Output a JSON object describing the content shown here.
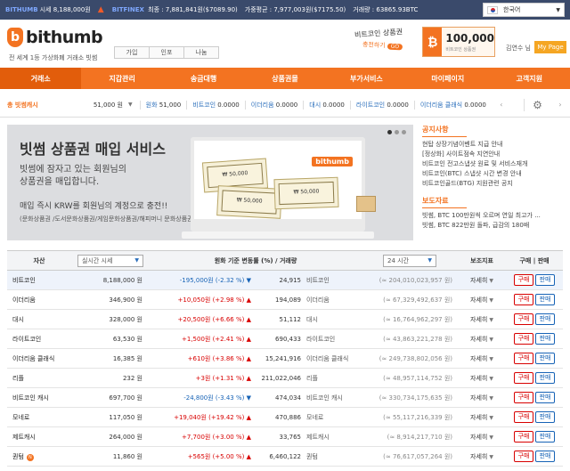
{
  "topbar": {
    "brand1": "BITHUMB",
    "label1": "시세",
    "value1": "8,188,000원",
    "brand2": "BITFINEX",
    "label2": "최종 : 7,881,841원($7089.90)",
    "label3": "가중평균 : 7,977,003원($7175.50)",
    "label4": "거래량 : 63865.93BTC",
    "language": "한국어"
  },
  "header": {
    "logo": "bithumb",
    "tagline": "전 세계 1등 가상화폐 거래소 빗썸",
    "quick": [
      "가입",
      "인포",
      "나눔"
    ],
    "gift_title": "비트코인 상품권",
    "gift_sub": "충전하기",
    "gift_go": "GO",
    "voucher_amount": "100,000",
    "voucher_caption": "비트코인 상품권",
    "user": "김연수 님",
    "mypage": "My Page"
  },
  "nav": [
    "거래소",
    "지갑관리",
    "송금대행",
    "상품권몰",
    "부가서비스",
    "마이페이지",
    "고객지원"
  ],
  "balance": {
    "label": "총 빗썸캐시",
    "amount": "51,000 원",
    "items": [
      {
        "k": "원화",
        "v": "51,000"
      },
      {
        "k": "비트코인",
        "v": "0.0000"
      },
      {
        "k": "이더리움",
        "v": "0.0000"
      },
      {
        "k": "대시",
        "v": "0.0000"
      },
      {
        "k": "라이트코인",
        "v": "0.0000"
      },
      {
        "k": "이더리움 클래식",
        "v": "0.0000"
      }
    ]
  },
  "banner": {
    "title": "빗썸 상품권 매입 서비스",
    "line1": "빗썸에 잠자고 있는 회원님의",
    "line2": "상품권을 매입합니다.",
    "line3": "매입 즉시 KRW를 회원님의 계정으로 충전!!",
    "line4": "(문화상품권 /도서문화상품권/게임문화상품권/해피머니 문화상품권)",
    "screen_logo": "bithumb",
    "ticket_amount": "₩ 50,000"
  },
  "notices": {
    "title": "공지사항",
    "items": [
      "현탑 상장기념이벤트 지급 안내",
      "[정상화] 사이트점속 지연안내",
      "비트코인 전고스냅샷 원료 및 서비스재개",
      "비트코인(BTC) 스냅샷 시간 변경 안내",
      "비트코인골드(BTG) 지원관련 공지"
    ],
    "press_title": "보도자료",
    "press": [
      "빗썸, BTC 100만원씩 오르며 연일 최고가 ...",
      "빗썸, BTC 822만원 돌파, 급감의 180배"
    ]
  },
  "table": {
    "headers": {
      "asset": "자산",
      "price_select": "실시간 시세",
      "change": "원화 기준 변동률 (%) / 거래량",
      "period_select": "24 시간",
      "indicator": "보조지표",
      "trade": "구매 | 판매"
    },
    "detail_label": "자세히",
    "buy_label": "구매",
    "sell_label": "판매",
    "rows": [
      {
        "name": "비트코인",
        "price": "8,188,000 원",
        "chg": "-195,000원 (-2.32 %)",
        "dir": "down",
        "vol": "24,915",
        "unit": "비트코인",
        "krw": "(≈ 204,010,023,957 원)"
      },
      {
        "name": "이더리움",
        "price": "346,900 원",
        "chg": "+10,050원 (+2.98 %)",
        "dir": "up",
        "vol": "194,089",
        "unit": "이더리움",
        "krw": "(≈ 67,329,492,637 원)"
      },
      {
        "name": "대시",
        "price": "328,000 원",
        "chg": "+20,500원 (+6.66 %)",
        "dir": "up",
        "vol": "51,112",
        "unit": "대시",
        "krw": "(≈ 16,764,962,297 원)"
      },
      {
        "name": "라이트코인",
        "price": "63,530 원",
        "chg": "+1,500원 (+2.41 %)",
        "dir": "up",
        "vol": "690,433",
        "unit": "라이트코인",
        "krw": "(≈ 43,863,221,278 원)"
      },
      {
        "name": "이더리움 클래식",
        "price": "16,385 원",
        "chg": "+610원 (+3.86 %)",
        "dir": "up",
        "vol": "15,241,916",
        "unit": "이더리움 클래식",
        "krw": "(≈ 249,738,802,056 원)"
      },
      {
        "name": "리플",
        "price": "232 원",
        "chg": "+3원 (+1.31 %)",
        "dir": "up",
        "vol": "211,022,046",
        "unit": "리플",
        "krw": "(≈ 48,957,114,752 원)"
      },
      {
        "name": "비트코인 캐시",
        "price": "697,700 원",
        "chg": "-24,800원 (-3.43 %)",
        "dir": "down",
        "vol": "474,034",
        "unit": "비트코인 캐시",
        "krw": "(≈ 330,734,175,635 원)"
      },
      {
        "name": "모네로",
        "price": "117,050 원",
        "chg": "+19,040원 (+19.42 %)",
        "dir": "up",
        "vol": "470,886",
        "unit": "모네로",
        "krw": "(≈ 55,117,216,339 원)"
      },
      {
        "name": "제트캐시",
        "price": "264,000 원",
        "chg": "+7,700원 (+3.00 %)",
        "dir": "up",
        "vol": "33,765",
        "unit": "제트캐시",
        "krw": "(≈ 8,914,217,710 원)"
      },
      {
        "name": "퀀텀",
        "price": "11,860 원",
        "chg": "+565원 (+5.00 %)",
        "dir": "up",
        "vol": "6,460,122",
        "unit": "퀀텀",
        "krw": "(≈ 76,617,057,264 원)"
      }
    ]
  },
  "colors": {
    "brand": "#f37321",
    "up": "#d80000",
    "down": "#1763b6",
    "topbar": "#3a4a6b"
  }
}
